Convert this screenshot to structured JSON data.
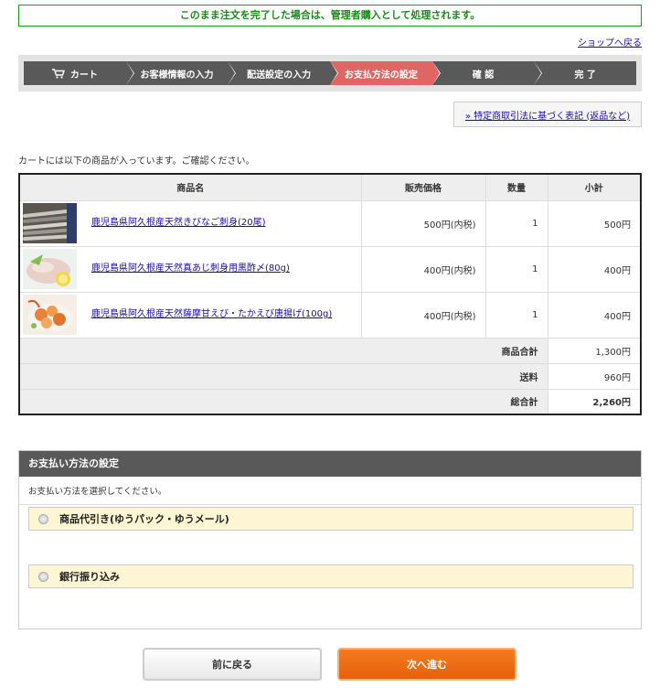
{
  "notice": "このまま注文を完了した場合は、管理者購入として処理されます。",
  "shop_link": "ショップへ戻る",
  "steps": [
    "カート",
    "お客様情報の入力",
    "配送設定の入力",
    "お支払方法の設定",
    "確 認",
    "完 了"
  ],
  "active_step": 3,
  "legal_link": "» 特定商取引法に基づく表記 (返品など)",
  "cart_message": "カートには以下の商品が入っています。ご確認ください。",
  "table": {
    "headers": [
      "商品名",
      "販売価格",
      "数量",
      "小計"
    ],
    "rows": [
      {
        "name": "鹿児島県阿久根産天然きびなご刺身(20尾)",
        "price": "500円(内税)",
        "qty": "1",
        "subtotal": "500円"
      },
      {
        "name": "鹿児島県阿久根産天然真あじ刺身用黒酢〆(80g)",
        "price": "400円(内税)",
        "qty": "1",
        "subtotal": "400円"
      },
      {
        "name": "鹿児島県阿久根産天然薩摩甘えび・たかえび唐揚げ(100g)",
        "price": "400円(内税)",
        "qty": "1",
        "subtotal": "400円"
      }
    ],
    "summary": [
      {
        "label": "商品合計",
        "value": "1,300円"
      },
      {
        "label": "送料",
        "value": "960円"
      },
      {
        "label": "総合計",
        "value": "2,260円"
      }
    ]
  },
  "payment": {
    "title": "お支払い方法の設定",
    "description": "お支払い方法を選択してください。",
    "options": [
      "商品代引き(ゆうパック・ゆうメール)",
      "銀行振り込み"
    ]
  },
  "buttons": {
    "back": "前に戻る",
    "next": "次へ進む"
  },
  "colors": {
    "active_step": "#e06666",
    "step": "#595959",
    "next_button": "#f37a1f",
    "notice": "#1a8a1a"
  }
}
